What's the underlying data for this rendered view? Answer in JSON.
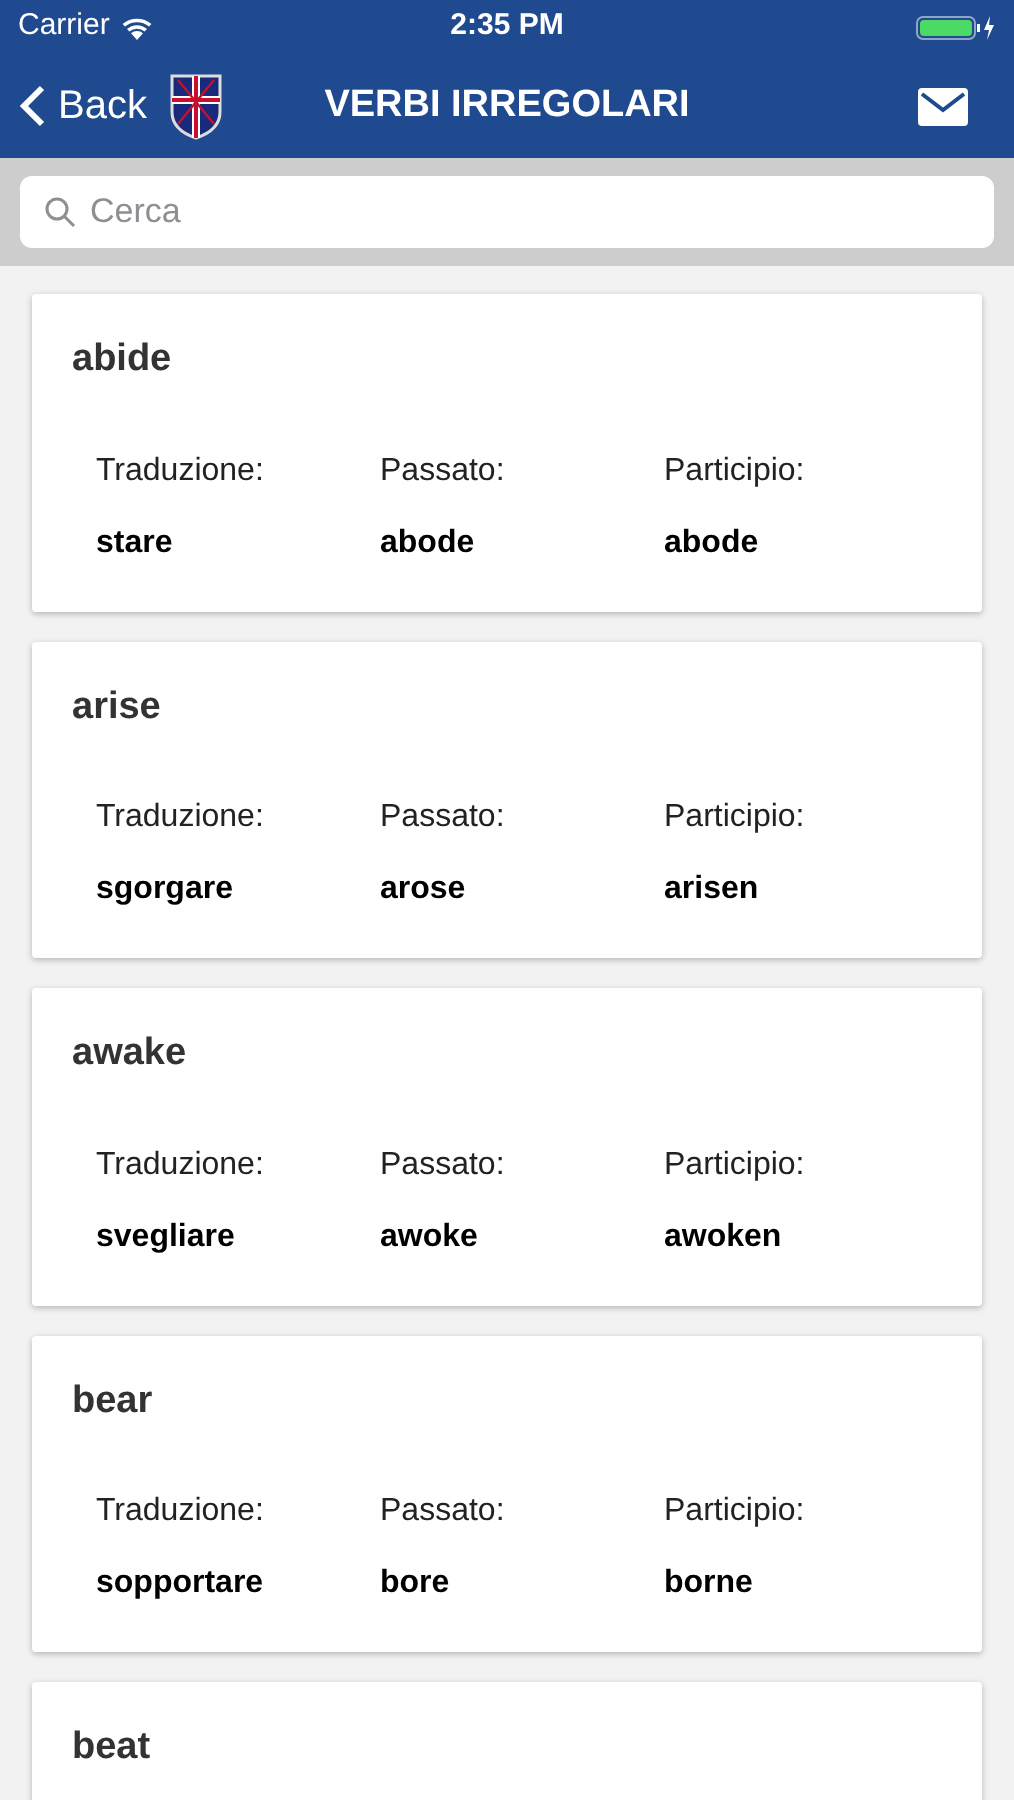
{
  "status_bar": {
    "carrier": "Carrier",
    "time": "2:35 PM"
  },
  "nav_bar": {
    "back": "Back",
    "title": "VERBI IRREGOLARI"
  },
  "search": {
    "placeholder": "Cerca"
  },
  "verbs": [
    {
      "word": "abide",
      "fields": [
        {
          "label": "Traduzione:",
          "value": "stare"
        },
        {
          "label": "Passato:",
          "value": "abode"
        },
        {
          "label": "Participio:",
          "value": "abode"
        }
      ]
    },
    {
      "word": "arise",
      "fields": [
        {
          "label": "Traduzione:",
          "value": "sgorgare"
        },
        {
          "label": "Passato:",
          "value": "arose"
        },
        {
          "label": "Participio:",
          "value": "arisen"
        }
      ]
    },
    {
      "word": "awake",
      "fields": [
        {
          "label": "Traduzione:",
          "value": "svegliare"
        },
        {
          "label": "Passato:",
          "value": "awoke"
        },
        {
          "label": "Participio:",
          "value": "awoken"
        }
      ]
    },
    {
      "word": "bear",
      "fields": [
        {
          "label": "Traduzione:",
          "value": "sopportare"
        },
        {
          "label": "Passato:",
          "value": "bore"
        },
        {
          "label": "Participio:",
          "value": "borne"
        }
      ]
    },
    {
      "word": "beat"
    }
  ]
}
